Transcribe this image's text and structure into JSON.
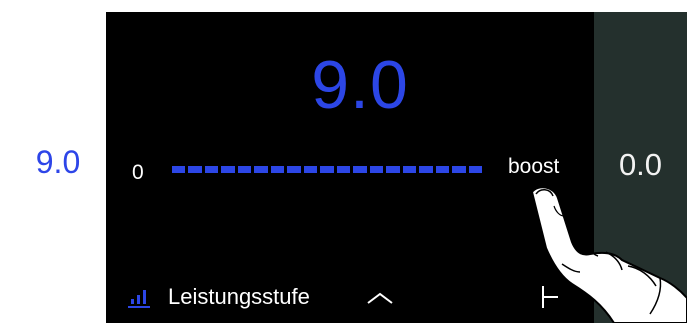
{
  "display": {
    "left_zone_value": "9.0",
    "main_value": "9.0",
    "right_zone_value": "0.0",
    "slider": {
      "min_label": "0",
      "max_label": "boost",
      "level": 1.0,
      "segments": 19,
      "color": "#2c46e6"
    },
    "footer": {
      "icon": "power-level-icon",
      "label": "Leistungsstufe",
      "expand_icon": "chevron-up-icon",
      "right_icon": "timer-icon"
    }
  },
  "colors": {
    "accent": "#2c46e6",
    "screen_bg": "#000000",
    "right_zone_bg": "#24302d",
    "left_zone_bg": "#ffffff"
  }
}
